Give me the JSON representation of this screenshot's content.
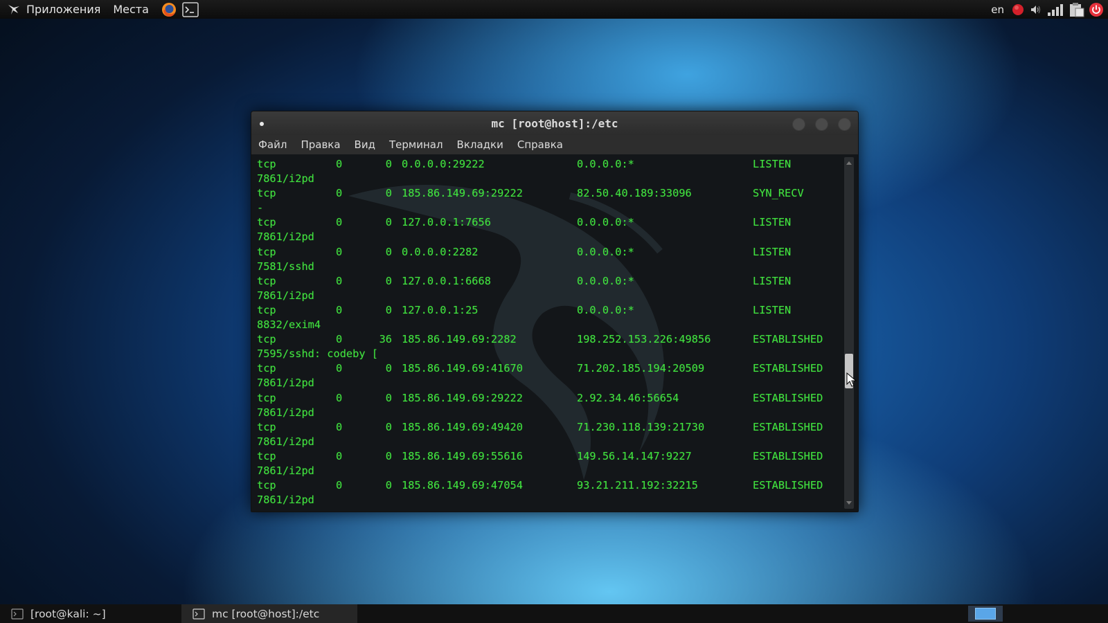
{
  "top_panel": {
    "applications_label": "Приложения",
    "places_label": "Места",
    "keyboard_layout": "en"
  },
  "window": {
    "title": "mc [root@host]:/etc",
    "menu": [
      "Файл",
      "Правка",
      "Вид",
      "Терминал",
      "Вкладки",
      "Справка"
    ]
  },
  "terminal": {
    "lines": [
      {
        "proto": "tcp",
        "recv": "0",
        "send": "0",
        "local": "0.0.0.0:29222",
        "foreign": "0.0.0.0:*",
        "state": "LISTEN"
      },
      {
        "text": "7861/i2pd"
      },
      {
        "proto": "tcp",
        "recv": "0",
        "send": "0",
        "local": "185.86.149.69:29222",
        "foreign": "82.50.40.189:33096",
        "state": "SYN_RECV"
      },
      {
        "text": "-"
      },
      {
        "proto": "tcp",
        "recv": "0",
        "send": "0",
        "local": "127.0.0.1:7656",
        "foreign": "0.0.0.0:*",
        "state": "LISTEN"
      },
      {
        "text": "7861/i2pd"
      },
      {
        "proto": "tcp",
        "recv": "0",
        "send": "0",
        "local": "0.0.0.0:2282",
        "foreign": "0.0.0.0:*",
        "state": "LISTEN"
      },
      {
        "text": "7581/sshd"
      },
      {
        "proto": "tcp",
        "recv": "0",
        "send": "0",
        "local": "127.0.0.1:6668",
        "foreign": "0.0.0.0:*",
        "state": "LISTEN"
      },
      {
        "text": "7861/i2pd"
      },
      {
        "proto": "tcp",
        "recv": "0",
        "send": "0",
        "local": "127.0.0.1:25",
        "foreign": "0.0.0.0:*",
        "state": "LISTEN"
      },
      {
        "text": "8832/exim4"
      },
      {
        "proto": "tcp",
        "recv": "0",
        "send": "36",
        "local": "185.86.149.69:2282",
        "foreign": "198.252.153.226:49856",
        "state": "ESTABLISHED"
      },
      {
        "text": "7595/sshd: codeby ["
      },
      {
        "proto": "tcp",
        "recv": "0",
        "send": "0",
        "local": "185.86.149.69:41670",
        "foreign": "71.202.185.194:20509",
        "state": "ESTABLISHED"
      },
      {
        "text": "7861/i2pd"
      },
      {
        "proto": "tcp",
        "recv": "0",
        "send": "0",
        "local": "185.86.149.69:29222",
        "foreign": "2.92.34.46:56654",
        "state": "ESTABLISHED"
      },
      {
        "text": "7861/i2pd"
      },
      {
        "proto": "tcp",
        "recv": "0",
        "send": "0",
        "local": "185.86.149.69:49420",
        "foreign": "71.230.118.139:21730",
        "state": "ESTABLISHED"
      },
      {
        "text": "7861/i2pd"
      },
      {
        "proto": "tcp",
        "recv": "0",
        "send": "0",
        "local": "185.86.149.69:55616",
        "foreign": "149.56.14.147:9227",
        "state": "ESTABLISHED"
      },
      {
        "text": "7861/i2pd"
      },
      {
        "proto": "tcp",
        "recv": "0",
        "send": "0",
        "local": "185.86.149.69:47054",
        "foreign": "93.21.211.192:32215",
        "state": "ESTABLISHED"
      },
      {
        "text": "7861/i2pd"
      }
    ]
  },
  "taskbar": {
    "tasks": [
      "[root@kali: ~]",
      "mc [root@host]:/etc"
    ]
  },
  "colors": {
    "terminal_text": "#41e23f",
    "terminal_background": "#131619",
    "panel_background": "#111111",
    "power_icon": "#e8323c"
  },
  "icons": {
    "applications": "kali-dragon-icon",
    "firefox": "firefox-icon",
    "terminal": "terminal-icon",
    "tray": [
      "notification-dot-icon",
      "volume-icon",
      "network-signal-icon",
      "clipboard-icon",
      "power-icon"
    ]
  }
}
